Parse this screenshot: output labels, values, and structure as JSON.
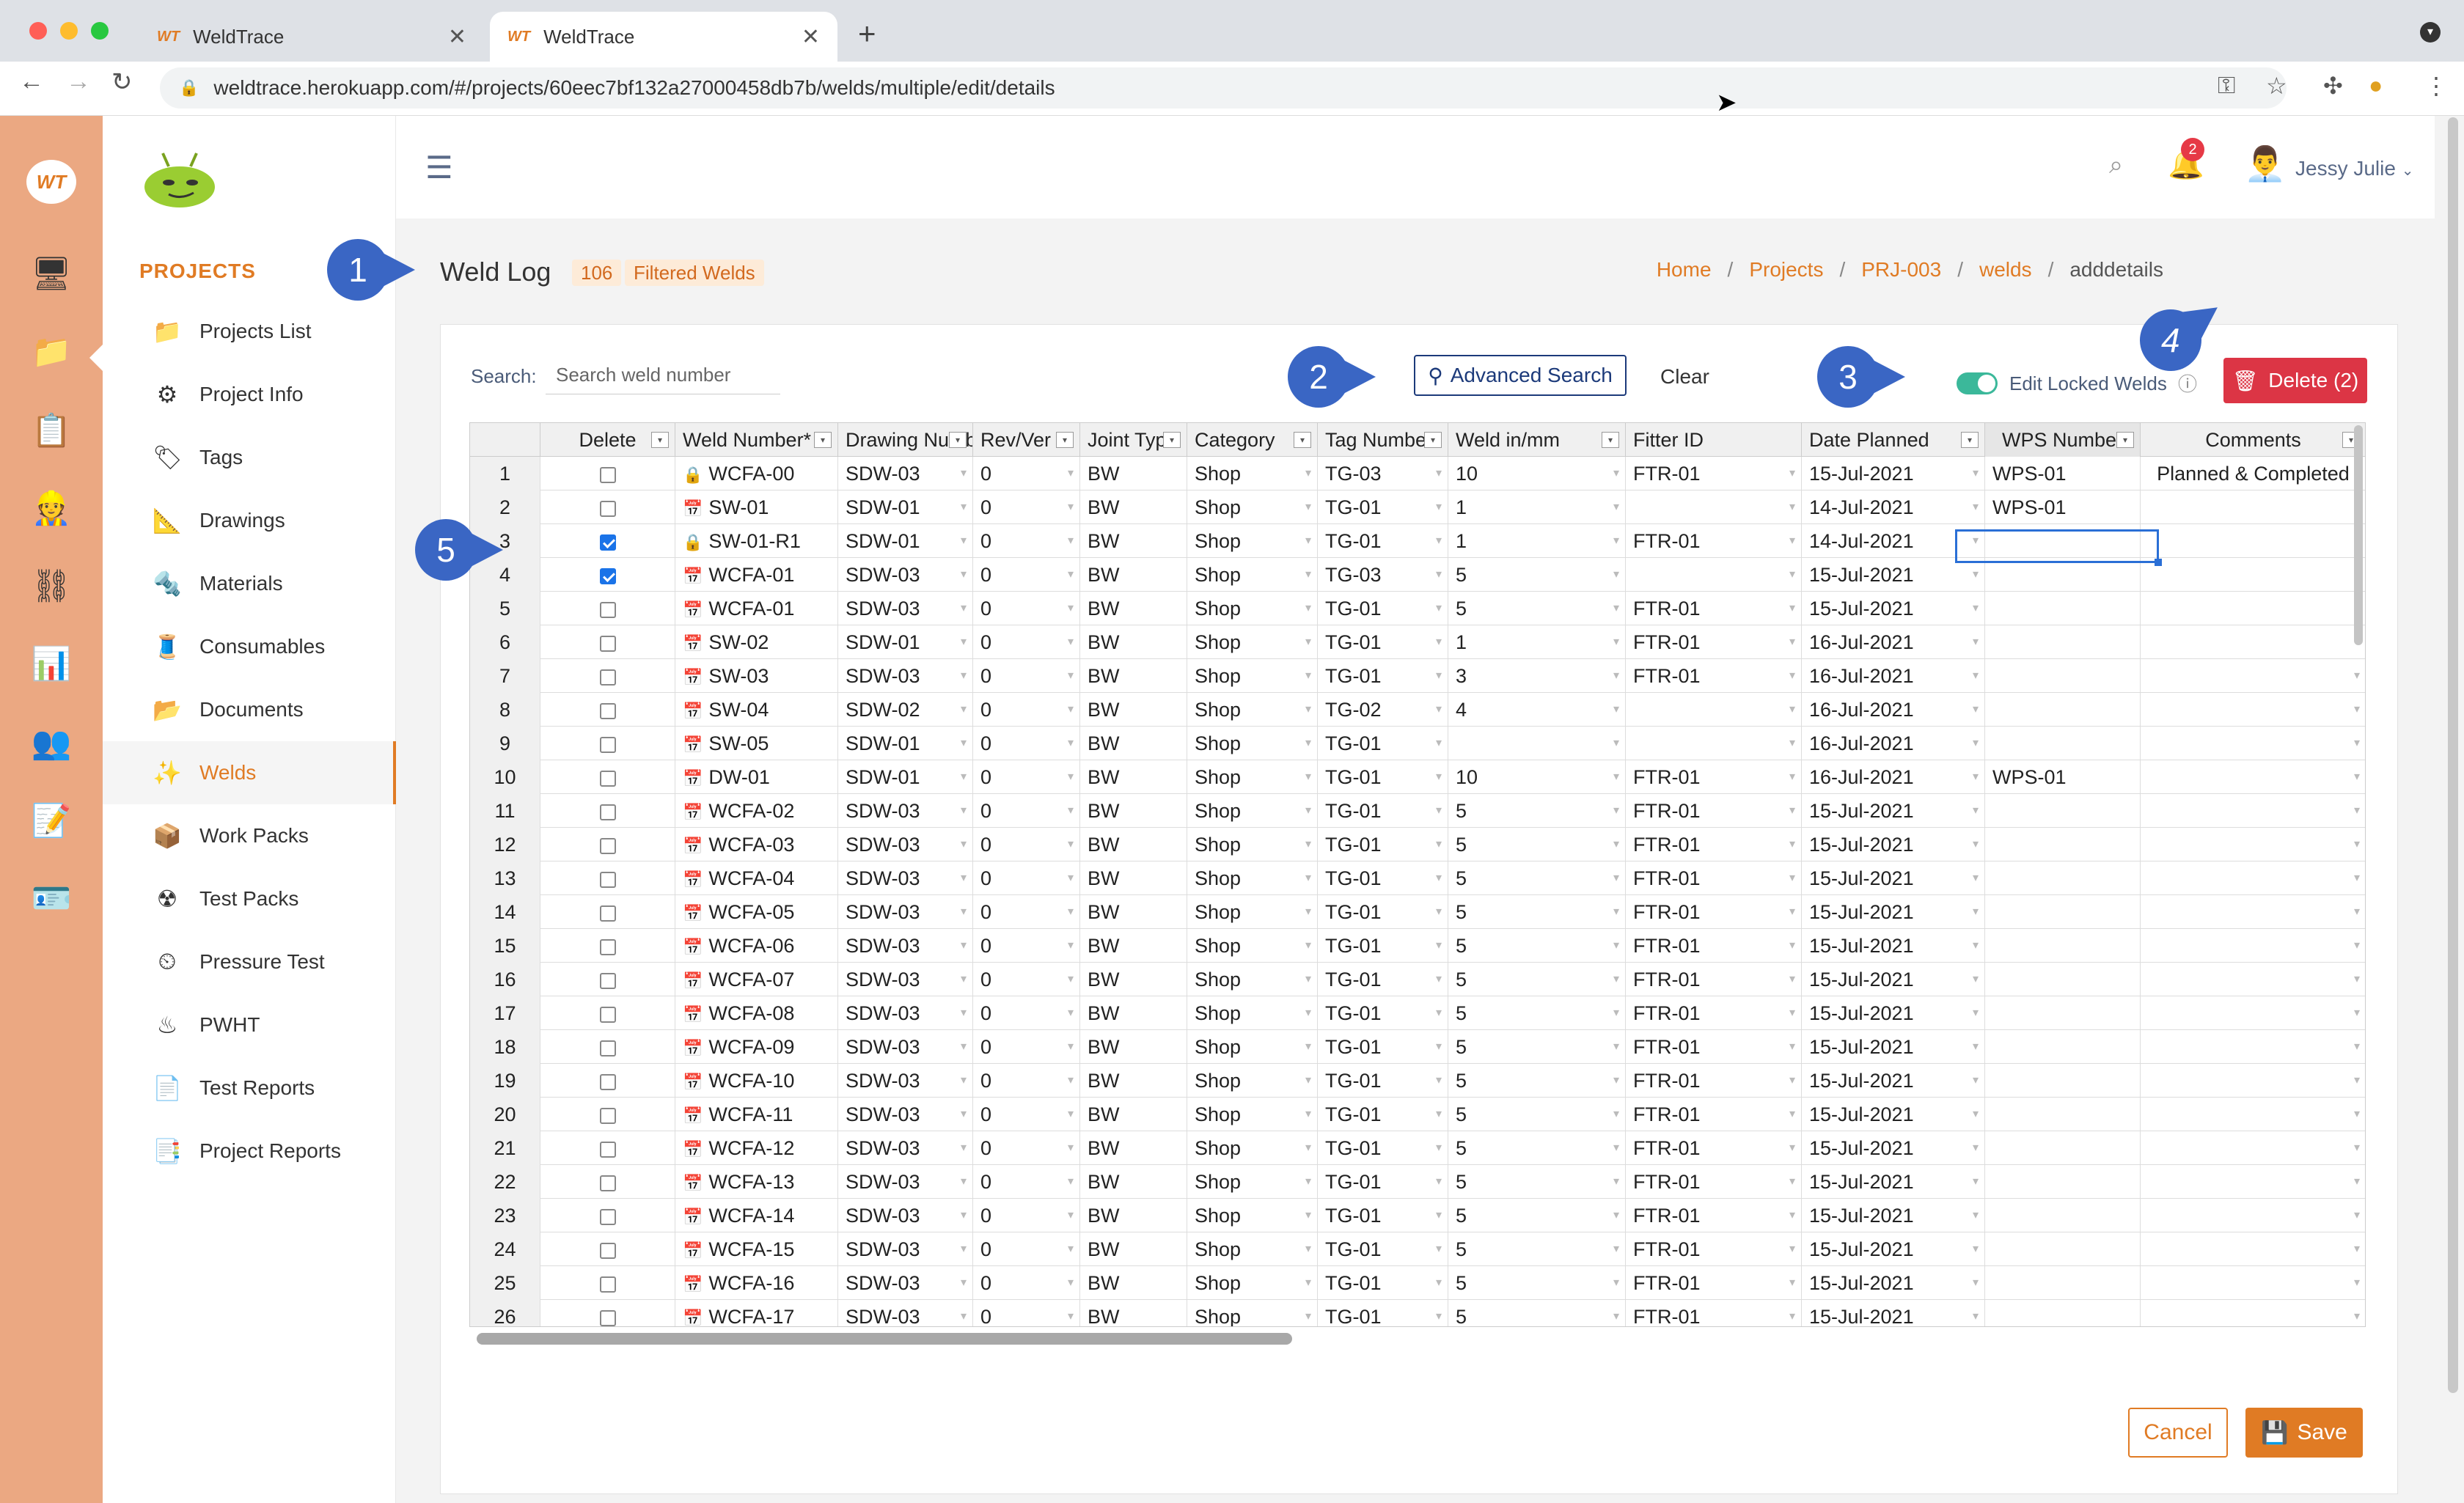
{
  "browser": {
    "tabs": [
      {
        "title": "WeldTrace",
        "logo": "WT"
      },
      {
        "title": "WeldTrace",
        "logo": "WT"
      }
    ],
    "url": "weldtrace.herokuapp.com/#/projects/60eec7bf132a27000458db7b/welds/multiple/edit/details"
  },
  "sidebar": {
    "section": "PROJECTS",
    "items": [
      {
        "label": "Projects List",
        "icon": "folder-camera-icon"
      },
      {
        "label": "Project Info",
        "icon": "gears-icon"
      },
      {
        "label": "Tags",
        "icon": "tag-icon"
      },
      {
        "label": "Drawings",
        "icon": "drafting-icon"
      },
      {
        "label": "Materials",
        "icon": "pipes-icon"
      },
      {
        "label": "Consumables",
        "icon": "spool-icon"
      },
      {
        "label": "Documents",
        "icon": "documents-icon"
      },
      {
        "label": "Welds",
        "icon": "weld-spark-icon"
      },
      {
        "label": "Work Packs",
        "icon": "work-pack-icon"
      },
      {
        "label": "Test Packs",
        "icon": "radiation-icon"
      },
      {
        "label": "Pressure Test",
        "icon": "gauge-icon"
      },
      {
        "label": "PWHT",
        "icon": "heater-icon"
      },
      {
        "label": "Test Reports",
        "icon": "report-icon"
      },
      {
        "label": "Project Reports",
        "icon": "project-report-icon"
      }
    ],
    "active": "Welds"
  },
  "header": {
    "notification_count": "2",
    "user_name": "Jessy Julie"
  },
  "page": {
    "title": "Weld Log",
    "count": "106",
    "filter_label": "Filtered Welds",
    "breadcrumb": [
      "Home",
      "Projects",
      "PRJ-003",
      "welds",
      "adddetails"
    ]
  },
  "toolbar": {
    "search_label": "Search:",
    "search_placeholder": "Search weld number",
    "advanced_search": "Advanced Search",
    "clear": "Clear",
    "edit_locked": "Edit Locked Welds",
    "delete": "Delete (2)"
  },
  "grid": {
    "columns": [
      "Delete",
      "Weld Number*",
      "Drawing Number",
      "Rev/Ver",
      "Joint Type",
      "Category",
      "Tag Number",
      "Weld in/mm",
      "Fitter ID",
      "Date Planned",
      "WPS Number",
      "Comments"
    ],
    "rows": [
      {
        "n": "1",
        "chk": false,
        "icon": "lock",
        "weld": "WCFA-00",
        "dwg": "SDW-03",
        "rev": "0",
        "jt": "BW",
        "cat": "Shop",
        "tag": "TG-03",
        "size": "10",
        "fitter": "FTR-01",
        "date": "15-Jul-2021",
        "wps": "WPS-01",
        "comments": "Planned & Completed"
      },
      {
        "n": "2",
        "chk": false,
        "icon": "calendar",
        "weld": "SW-01",
        "dwg": "SDW-01",
        "rev": "0",
        "jt": "BW",
        "cat": "Shop",
        "tag": "TG-01",
        "size": "1",
        "fitter": "",
        "date": "14-Jul-2021",
        "wps": "WPS-01",
        "comments": ""
      },
      {
        "n": "3",
        "chk": true,
        "icon": "lock",
        "weld": "SW-01-R1",
        "dwg": "SDW-01",
        "rev": "0",
        "jt": "BW",
        "cat": "Shop",
        "tag": "TG-01",
        "size": "1",
        "fitter": "FTR-01",
        "date": "14-Jul-2021",
        "wps": "",
        "comments": ""
      },
      {
        "n": "4",
        "chk": true,
        "icon": "calendar",
        "weld": "WCFA-01",
        "dwg": "SDW-03",
        "rev": "0",
        "jt": "BW",
        "cat": "Shop",
        "tag": "TG-03",
        "size": "5",
        "fitter": "",
        "date": "15-Jul-2021",
        "wps": "",
        "comments": ""
      },
      {
        "n": "5",
        "chk": false,
        "icon": "calendar",
        "weld": "WCFA-01",
        "dwg": "SDW-03",
        "rev": "0",
        "jt": "BW",
        "cat": "Shop",
        "tag": "TG-01",
        "size": "5",
        "fitter": "FTR-01",
        "date": "15-Jul-2021",
        "wps": "",
        "comments": ""
      },
      {
        "n": "6",
        "chk": false,
        "icon": "calendar",
        "weld": "SW-02",
        "dwg": "SDW-01",
        "rev": "0",
        "jt": "BW",
        "cat": "Shop",
        "tag": "TG-01",
        "size": "1",
        "fitter": "FTR-01",
        "date": "16-Jul-2021",
        "wps": "",
        "comments": ""
      },
      {
        "n": "7",
        "chk": false,
        "icon": "calendar",
        "weld": "SW-03",
        "dwg": "SDW-03",
        "rev": "0",
        "jt": "BW",
        "cat": "Shop",
        "tag": "TG-01",
        "size": "3",
        "fitter": "FTR-01",
        "date": "16-Jul-2021",
        "wps": "",
        "comments": ""
      },
      {
        "n": "8",
        "chk": false,
        "icon": "calendar",
        "weld": "SW-04",
        "dwg": "SDW-02",
        "rev": "0",
        "jt": "BW",
        "cat": "Shop",
        "tag": "TG-02",
        "size": "4",
        "fitter": "",
        "date": "16-Jul-2021",
        "wps": "",
        "comments": ""
      },
      {
        "n": "9",
        "chk": false,
        "icon": "calendar",
        "weld": "SW-05",
        "dwg": "SDW-01",
        "rev": "0",
        "jt": "BW",
        "cat": "Shop",
        "tag": "TG-01",
        "size": "",
        "fitter": "",
        "date": "16-Jul-2021",
        "wps": "",
        "comments": ""
      },
      {
        "n": "10",
        "chk": false,
        "icon": "calendar",
        "weld": "DW-01",
        "dwg": "SDW-01",
        "rev": "0",
        "jt": "BW",
        "cat": "Shop",
        "tag": "TG-01",
        "size": "10",
        "fitter": "FTR-01",
        "date": "16-Jul-2021",
        "wps": "WPS-01",
        "comments": ""
      },
      {
        "n": "11",
        "chk": false,
        "icon": "calendar",
        "weld": "WCFA-02",
        "dwg": "SDW-03",
        "rev": "0",
        "jt": "BW",
        "cat": "Shop",
        "tag": "TG-01",
        "size": "5",
        "fitter": "FTR-01",
        "date": "15-Jul-2021",
        "wps": "",
        "comments": ""
      },
      {
        "n": "12",
        "chk": false,
        "icon": "calendar",
        "weld": "WCFA-03",
        "dwg": "SDW-03",
        "rev": "0",
        "jt": "BW",
        "cat": "Shop",
        "tag": "TG-01",
        "size": "5",
        "fitter": "FTR-01",
        "date": "15-Jul-2021",
        "wps": "",
        "comments": ""
      },
      {
        "n": "13",
        "chk": false,
        "icon": "calendar",
        "weld": "WCFA-04",
        "dwg": "SDW-03",
        "rev": "0",
        "jt": "BW",
        "cat": "Shop",
        "tag": "TG-01",
        "size": "5",
        "fitter": "FTR-01",
        "date": "15-Jul-2021",
        "wps": "",
        "comments": ""
      },
      {
        "n": "14",
        "chk": false,
        "icon": "calendar",
        "weld": "WCFA-05",
        "dwg": "SDW-03",
        "rev": "0",
        "jt": "BW",
        "cat": "Shop",
        "tag": "TG-01",
        "size": "5",
        "fitter": "FTR-01",
        "date": "15-Jul-2021",
        "wps": "",
        "comments": ""
      },
      {
        "n": "15",
        "chk": false,
        "icon": "calendar",
        "weld": "WCFA-06",
        "dwg": "SDW-03",
        "rev": "0",
        "jt": "BW",
        "cat": "Shop",
        "tag": "TG-01",
        "size": "5",
        "fitter": "FTR-01",
        "date": "15-Jul-2021",
        "wps": "",
        "comments": ""
      },
      {
        "n": "16",
        "chk": false,
        "icon": "calendar",
        "weld": "WCFA-07",
        "dwg": "SDW-03",
        "rev": "0",
        "jt": "BW",
        "cat": "Shop",
        "tag": "TG-01",
        "size": "5",
        "fitter": "FTR-01",
        "date": "15-Jul-2021",
        "wps": "",
        "comments": ""
      },
      {
        "n": "17",
        "chk": false,
        "icon": "calendar",
        "weld": "WCFA-08",
        "dwg": "SDW-03",
        "rev": "0",
        "jt": "BW",
        "cat": "Shop",
        "tag": "TG-01",
        "size": "5",
        "fitter": "FTR-01",
        "date": "15-Jul-2021",
        "wps": "",
        "comments": ""
      },
      {
        "n": "18",
        "chk": false,
        "icon": "calendar",
        "weld": "WCFA-09",
        "dwg": "SDW-03",
        "rev": "0",
        "jt": "BW",
        "cat": "Shop",
        "tag": "TG-01",
        "size": "5",
        "fitter": "FTR-01",
        "date": "15-Jul-2021",
        "wps": "",
        "comments": ""
      },
      {
        "n": "19",
        "chk": false,
        "icon": "calendar",
        "weld": "WCFA-10",
        "dwg": "SDW-03",
        "rev": "0",
        "jt": "BW",
        "cat": "Shop",
        "tag": "TG-01",
        "size": "5",
        "fitter": "FTR-01",
        "date": "15-Jul-2021",
        "wps": "",
        "comments": ""
      },
      {
        "n": "20",
        "chk": false,
        "icon": "calendar",
        "weld": "WCFA-11",
        "dwg": "SDW-03",
        "rev": "0",
        "jt": "BW",
        "cat": "Shop",
        "tag": "TG-01",
        "size": "5",
        "fitter": "FTR-01",
        "date": "15-Jul-2021",
        "wps": "",
        "comments": ""
      },
      {
        "n": "21",
        "chk": false,
        "icon": "calendar",
        "weld": "WCFA-12",
        "dwg": "SDW-03",
        "rev": "0",
        "jt": "BW",
        "cat": "Shop",
        "tag": "TG-01",
        "size": "5",
        "fitter": "FTR-01",
        "date": "15-Jul-2021",
        "wps": "",
        "comments": ""
      },
      {
        "n": "22",
        "chk": false,
        "icon": "calendar",
        "weld": "WCFA-13",
        "dwg": "SDW-03",
        "rev": "0",
        "jt": "BW",
        "cat": "Shop",
        "tag": "TG-01",
        "size": "5",
        "fitter": "FTR-01",
        "date": "15-Jul-2021",
        "wps": "",
        "comments": ""
      },
      {
        "n": "23",
        "chk": false,
        "icon": "calendar",
        "weld": "WCFA-14",
        "dwg": "SDW-03",
        "rev": "0",
        "jt": "BW",
        "cat": "Shop",
        "tag": "TG-01",
        "size": "5",
        "fitter": "FTR-01",
        "date": "15-Jul-2021",
        "wps": "",
        "comments": ""
      },
      {
        "n": "24",
        "chk": false,
        "icon": "calendar",
        "weld": "WCFA-15",
        "dwg": "SDW-03",
        "rev": "0",
        "jt": "BW",
        "cat": "Shop",
        "tag": "TG-01",
        "size": "5",
        "fitter": "FTR-01",
        "date": "15-Jul-2021",
        "wps": "",
        "comments": ""
      },
      {
        "n": "25",
        "chk": false,
        "icon": "calendar",
        "weld": "WCFA-16",
        "dwg": "SDW-03",
        "rev": "0",
        "jt": "BW",
        "cat": "Shop",
        "tag": "TG-01",
        "size": "5",
        "fitter": "FTR-01",
        "date": "15-Jul-2021",
        "wps": "",
        "comments": ""
      },
      {
        "n": "26",
        "chk": false,
        "icon": "calendar",
        "weld": "WCFA-17",
        "dwg": "SDW-03",
        "rev": "0",
        "jt": "BW",
        "cat": "Shop",
        "tag": "TG-01",
        "size": "5",
        "fitter": "FTR-01",
        "date": "15-Jul-2021",
        "wps": "",
        "comments": ""
      }
    ]
  },
  "footer": {
    "cancel": "Cancel",
    "save": "Save"
  },
  "callouts": [
    "1",
    "2",
    "3",
    "4",
    "5"
  ],
  "colors": {
    "accent": "#e07b24",
    "rail": "#eba882",
    "delete": "#dc3545",
    "toggle": "#3bb89a",
    "callout": "#3a66c4"
  }
}
